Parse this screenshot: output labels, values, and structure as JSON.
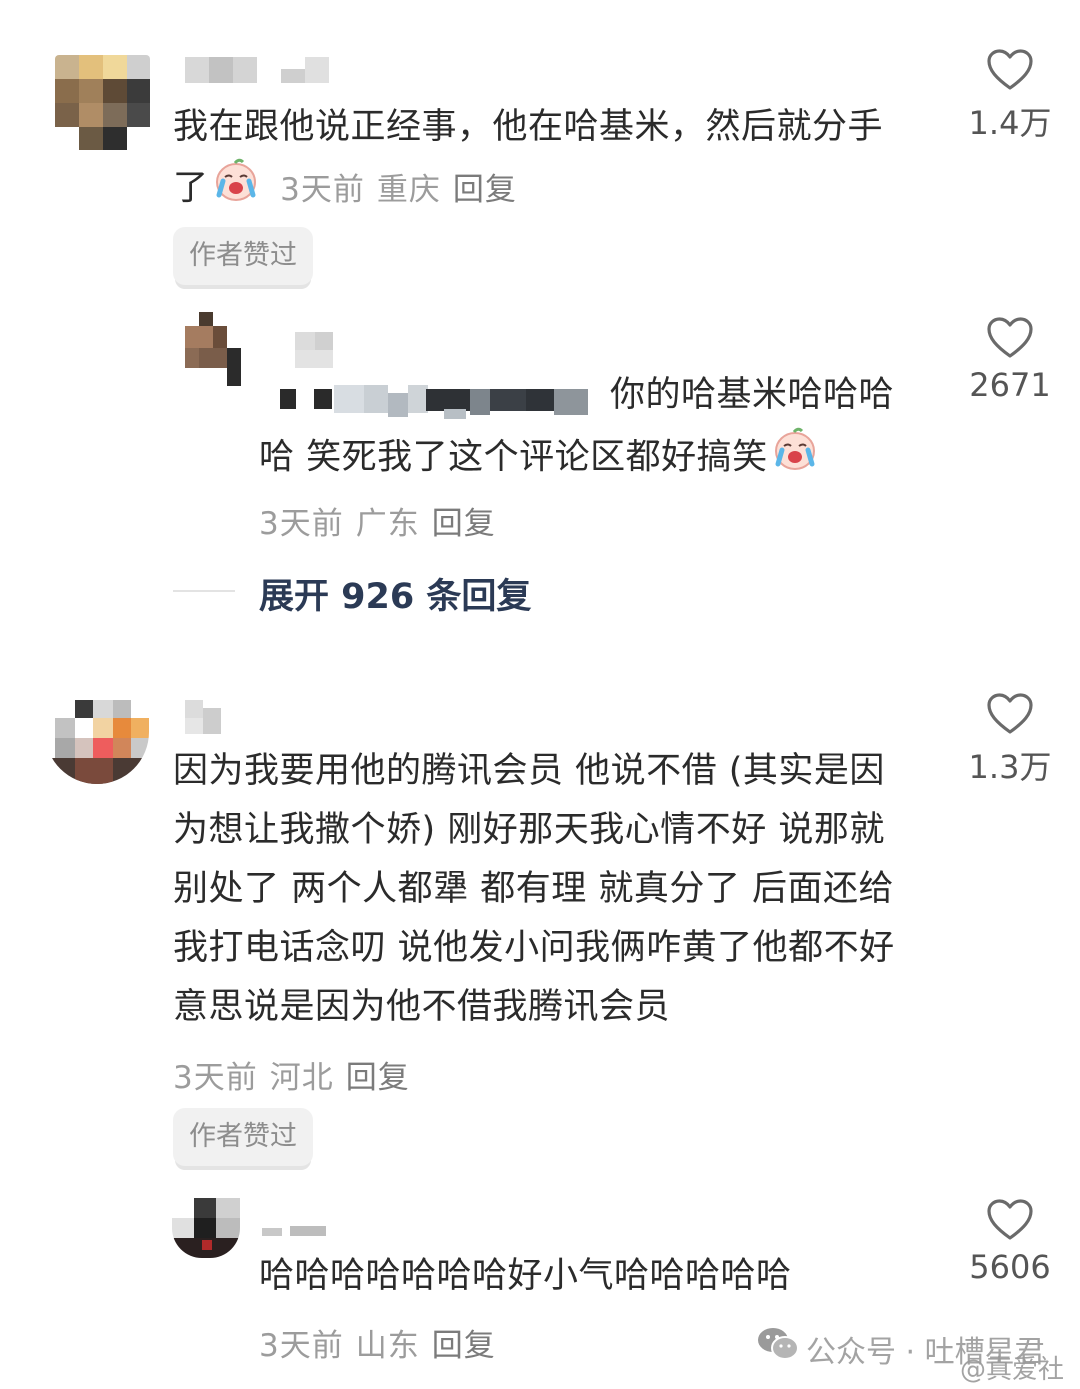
{
  "comments": [
    {
      "text_line1": "我在跟他说正经事，他在哈基米，然后就分手",
      "text_line2": "了",
      "time": "3天前",
      "location": "重庆",
      "reply": "回复",
      "badge": "作者赞过",
      "likes": "1.4万"
    },
    {
      "text_line1": "你的哈基米哈哈哈",
      "text_line2": "哈 笑死我了这个评论区都好搞笑",
      "time": "3天前",
      "location": "广东",
      "reply": "回复",
      "likes": "2671"
    },
    {
      "text_line1": "因为我要用他的腾讯会员 他说不借 (其实是因",
      "text_line2": "为想让我撒个娇) 刚好那天我心情不好 说那就",
      "text_line3": "别处了  两个人都犟 都有理 就真分了 后面还给",
      "text_line4": "我打电话念叨 说他发小问我俩咋黄了他都不好",
      "text_line5": "意思说是因为他不借我腾讯会员",
      "time": "3天前",
      "location": "河北",
      "reply": "回复",
      "badge": "作者赞过",
      "likes": "1.3万"
    },
    {
      "text_line1": "哈哈哈哈哈哈哈好小气哈哈哈哈哈",
      "time": "3天前",
      "location": "山东",
      "reply": "回复",
      "likes": "5606"
    }
  ],
  "expand_replies": "展开 926 条回复",
  "watermark": {
    "wechat": "公众号 · 吐槽星君",
    "weibo": "@真爱社"
  },
  "colors": {
    "meta": "#9c9c9c",
    "text": "#2b2b2b",
    "badge_bg": "#f1f1f1",
    "expand": "#2b3a55"
  },
  "icons": {
    "like": "heart-outline-icon",
    "emoji": "crying-laughing-emoji-icon",
    "wechat": "wechat-logo-icon"
  }
}
